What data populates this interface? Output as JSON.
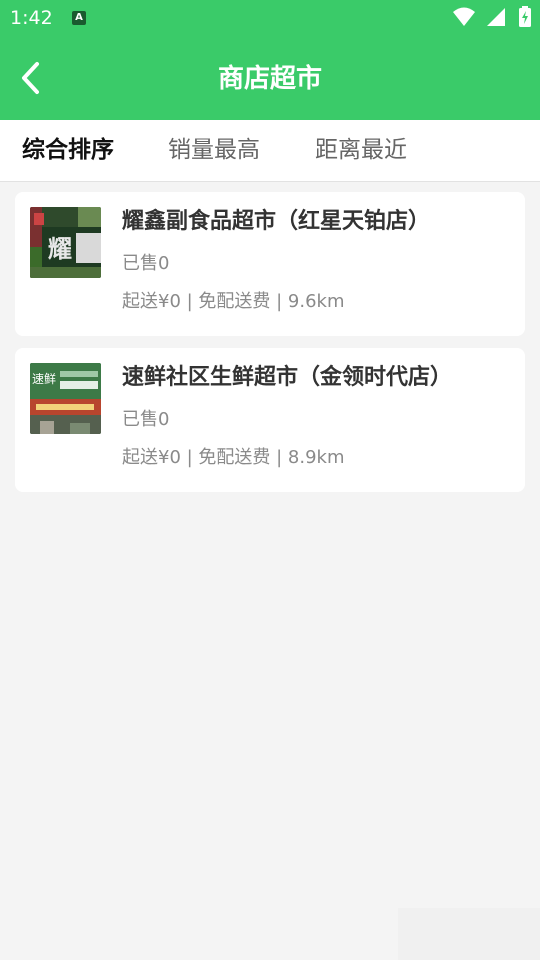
{
  "status_bar": {
    "time": "1:42",
    "notification_glyph": "A",
    "icons": [
      "wifi-icon",
      "signal-icon",
      "battery-icon"
    ]
  },
  "header": {
    "title": "商店超市",
    "back_icon": "chevron-left-icon"
  },
  "tabs": [
    {
      "label": "综合排序",
      "active": true
    },
    {
      "label": "销量最高",
      "active": false
    },
    {
      "label": "距离最近",
      "active": false
    }
  ],
  "stores": [
    {
      "name": "耀鑫副食品超市（红星天铂店）",
      "sold": "已售0",
      "meta": "起送¥0 | 免配送费 | 9.6km"
    },
    {
      "name": "速鲜社区生鲜超市（金领时代店）",
      "sold": "已售0",
      "meta": "起送¥0 | 免配送费 | 8.9km"
    }
  ],
  "colors": {
    "primary_green": "#3acb69",
    "background": "#f4f4f4",
    "card": "#ffffff",
    "muted_text": "#8a8a8a"
  }
}
